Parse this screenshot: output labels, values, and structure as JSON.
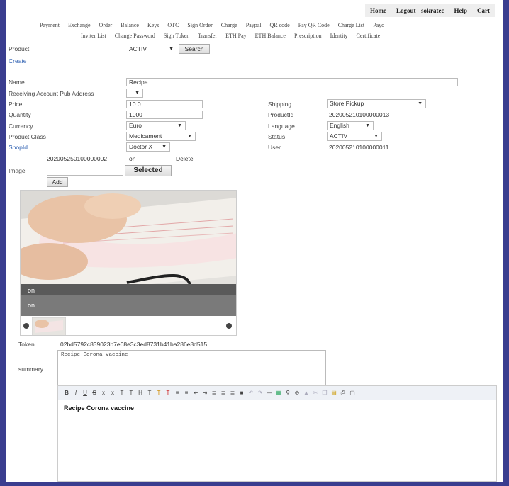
{
  "topnav": {
    "home": "Home",
    "logout": "Logout - sokratec",
    "help": "Help",
    "cart": "Cart"
  },
  "nav1": [
    "Payment",
    "Exchange",
    "Order",
    "Balance",
    "Keys",
    "OTC",
    "Sign Order",
    "Charge",
    "Paypal",
    "QR code",
    "Pay QR Code",
    "Charge List",
    "Payo"
  ],
  "nav2": [
    "Inviter List",
    "Change Password",
    "Sign Token",
    "Transfer",
    "ETH Pay",
    "ETH Balance",
    "Prescription",
    "Identity",
    "Certificate"
  ],
  "search": {
    "label": "Product",
    "value": "",
    "status": "ACTIV",
    "button": "Search"
  },
  "create": "Create",
  "form": {
    "name_label": "Name",
    "name_value": "Recipe",
    "pub_label": "Receiving Account Pub Address",
    "price_label": "Price",
    "price_value": "10.0",
    "quantity_label": "Quantity",
    "quantity_value": "1000",
    "currency_label": "Currency",
    "currency_value": "Euro",
    "class_label": "Product Class",
    "class_value": "Medicament",
    "shop_label": "ShopId",
    "shop_value": "Doctor X",
    "shipping_label": "Shipping",
    "shipping_value": "Store Pickup",
    "productid_label": "ProductId",
    "productid_value": "202005210100000013",
    "language_label": "Language",
    "language_value": "English",
    "status_label": "Status",
    "status_value": "ACTIV",
    "user_label": "User",
    "user_value": "202005210100000011",
    "shop_row_id": "202005250100000002",
    "shop_row_on": "on",
    "shop_row_delete": "Delete",
    "image_label": "Image",
    "image_button": "Selected",
    "add_button": "Add"
  },
  "photo": {
    "caption1": "on",
    "caption2": "on"
  },
  "token": {
    "label": "Token",
    "value": "02bd5792c839023b7e68e3c3ed8731b41ba286e8d515"
  },
  "summary": {
    "label": "summary",
    "value": "Recipe Corona vaccine"
  },
  "editor": {
    "content": "Recipe Corona vaccine"
  }
}
